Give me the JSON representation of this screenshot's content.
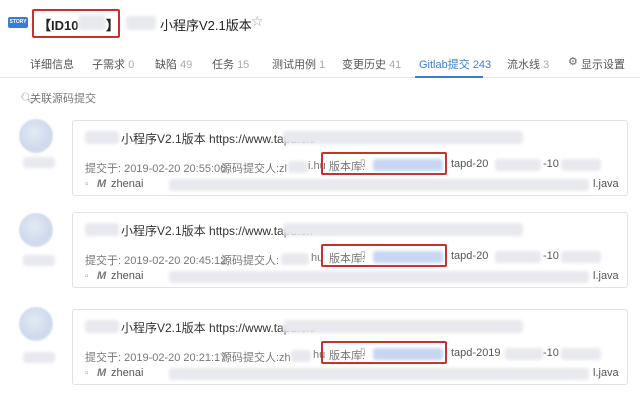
{
  "header": {
    "badge": "STORY",
    "id_prefix": "【ID10",
    "id_suffix": "】",
    "title": "小程序V2.1版本",
    "star_icon": "star-outline-icon"
  },
  "tabs": [
    {
      "label": "详细信息",
      "count": ""
    },
    {
      "label": "子需求",
      "count": "0"
    },
    {
      "label": "缺陷",
      "count": "49"
    },
    {
      "label": "任务",
      "count": "15"
    },
    {
      "label": "测试用例",
      "count": "1"
    },
    {
      "label": "变更历史",
      "count": "41"
    },
    {
      "label": "Gitlab提交",
      "count": "243"
    },
    {
      "label": "流水线",
      "count": "3"
    },
    {
      "label": "显示设置",
      "count": ""
    }
  ],
  "active_tab": "Gitlab提交",
  "search": {
    "placeholder": "关联源码提交"
  },
  "commits": [
    {
      "title": "小程序V2.1版本 https://www.tapd.cn/",
      "committed_label": "提交于: 2019-02-20 20:55:06",
      "author_label": "源码提交人:zl",
      "author_tail": "i.hu",
      "repo_label": "版本库:",
      "branch_prefix": "tapd-20",
      "branch_tail": "-10",
      "change_author": "zhenai",
      "file_ext": "l.java"
    },
    {
      "title": "小程序V2.1版本 https://www.tapd.cn",
      "committed_label": "提交于: 2019-02-20 20:45:12",
      "author_label": "源码提交人:",
      "author_tail": "hu",
      "repo_label": "版本库:",
      "branch_prefix": "tapd-20",
      "branch_tail": "-10",
      "change_author": "zhenai",
      "file_ext": "l.java"
    },
    {
      "title": "小程序V2.1版本 https://www.tapd.cn/",
      "committed_label": "提交于: 2019-02-20 20:21:17",
      "author_label": "源码提交人:zh",
      "author_tail": "hu",
      "repo_label": "版本库:",
      "branch_prefix": "tapd-2019",
      "branch_tail": "-10",
      "change_author": "zhenai",
      "file_ext": "l.java"
    }
  ],
  "colors": {
    "accent": "#3a7bd5",
    "highlight": "#c9302c"
  }
}
